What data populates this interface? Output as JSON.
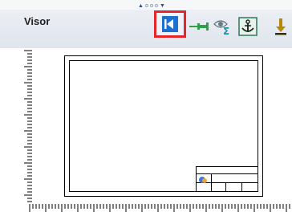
{
  "panel": {
    "title": "Visor"
  },
  "pager": {
    "dot_count": 3
  },
  "toolbar": {
    "buttons": [
      {
        "name": "collapse-panel",
        "icon": "collapse-left-icon",
        "highlighted": true,
        "highlight_color": "#e3262b",
        "color": "#1f6fd1"
      },
      {
        "name": "pin",
        "icon": "pin-icon",
        "color": "#2fa04a"
      },
      {
        "name": "view-sum",
        "icon": "eye-sum-icon",
        "color": "#2a8a9a"
      },
      {
        "name": "anchor",
        "icon": "anchor-icon",
        "color": "#2a7a5a"
      },
      {
        "name": "download",
        "icon": "download-arrow-icon",
        "color": "#b8860b"
      }
    ]
  },
  "drawing": {
    "type": "sheet-with-title-block"
  }
}
